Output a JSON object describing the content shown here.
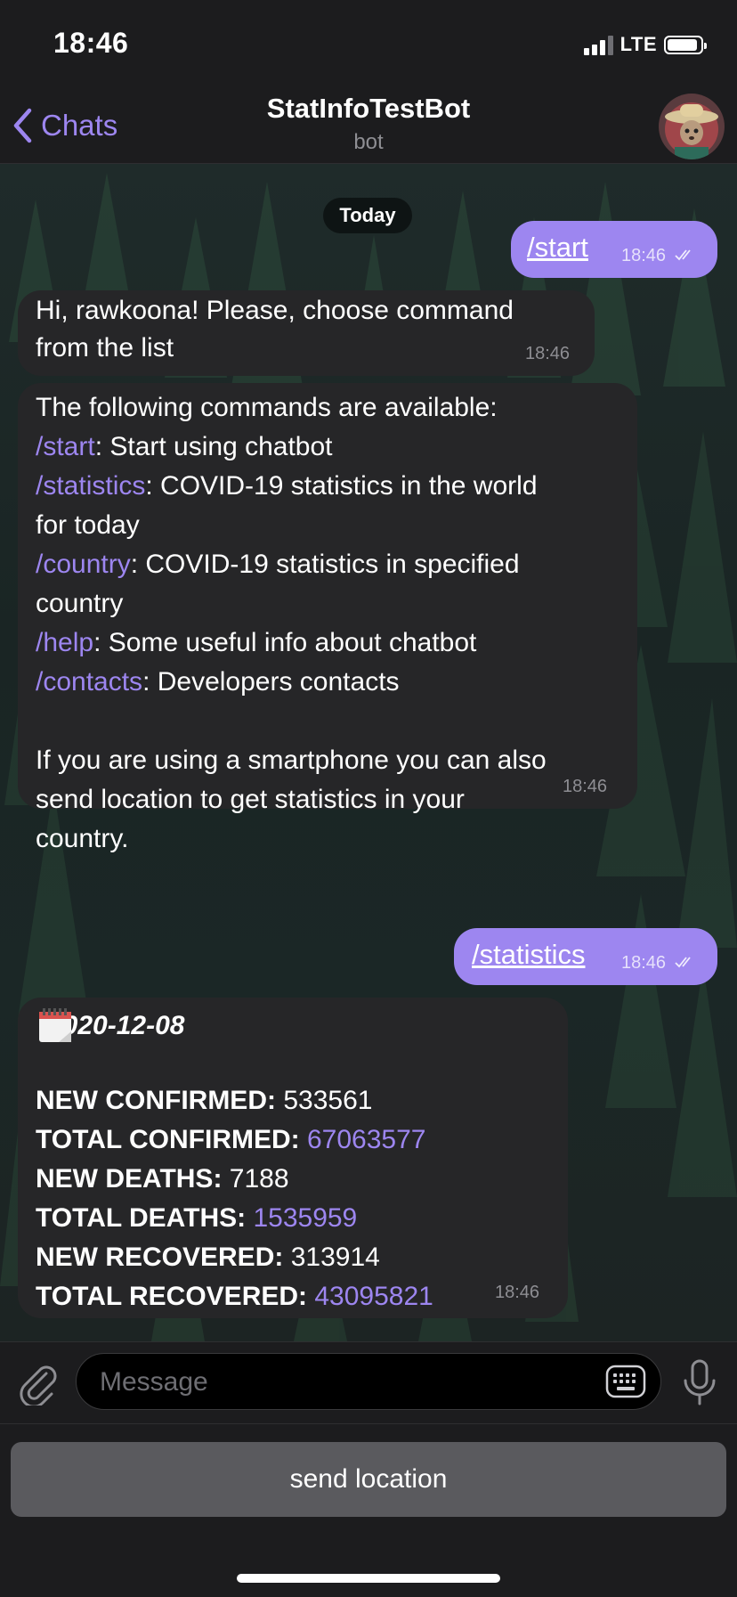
{
  "status_bar": {
    "time": "18:46",
    "network": "LTE"
  },
  "nav": {
    "back_label": "Chats",
    "title": "StatInfoTestBot",
    "subtitle": "bot"
  },
  "chat": {
    "date_separator": "Today",
    "messages": [
      {
        "from": "user",
        "text": "/start",
        "time": "18:46"
      },
      {
        "from": "bot",
        "lines": [
          "Hi, rawkoona! Please, choose command",
          "from the list"
        ],
        "time": "18:46"
      },
      {
        "from": "bot",
        "intro": "The following commands are available:",
        "commands": [
          {
            "cmd": "/start",
            "desc": ": Start using chatbot"
          },
          {
            "cmd": "/statistics",
            "desc": ": COVID-19 statistics in the world",
            "desc2": "for today"
          },
          {
            "cmd": "/country",
            "desc": ": COVID-19 statistics in specified",
            "desc2": "country"
          },
          {
            "cmd": "/help",
            "desc": ": Some useful info about chatbot"
          },
          {
            "cmd": "/contacts",
            "desc": ": Developers contacts"
          }
        ],
        "footer": [
          "If you are using a smartphone you can also",
          "send location to get statistics in your",
          "country."
        ],
        "time": "18:46"
      },
      {
        "from": "user",
        "text": "/statistics",
        "time": "18:46"
      },
      {
        "from": "bot",
        "date": "2020-12-08",
        "stats": [
          {
            "label": "NEW CONFIRMED:",
            "value": "533561"
          },
          {
            "label": "TOTAL CONFIRMED:",
            "value": "67063577"
          },
          {
            "label": "NEW DEATHS:",
            "value": "7188"
          },
          {
            "label": "TOTAL DEATHS:",
            "value": "1535959"
          },
          {
            "label": "NEW RECOVERED:",
            "value": "313914"
          },
          {
            "label": "TOTAL RECOVERED:",
            "value": "43095821"
          }
        ],
        "time": "18:46"
      }
    ]
  },
  "composer": {
    "placeholder": "Message"
  },
  "keyboard": {
    "button_label": "send location"
  },
  "colors": {
    "accent": "#9d86f0",
    "bubble_in": "#262628",
    "background": "#1c1c1e"
  },
  "icons": [
    "back-chevron-icon",
    "paperclip-icon",
    "keyboard-icon",
    "microphone-icon",
    "double-check-icon",
    "calendar-icon"
  ]
}
